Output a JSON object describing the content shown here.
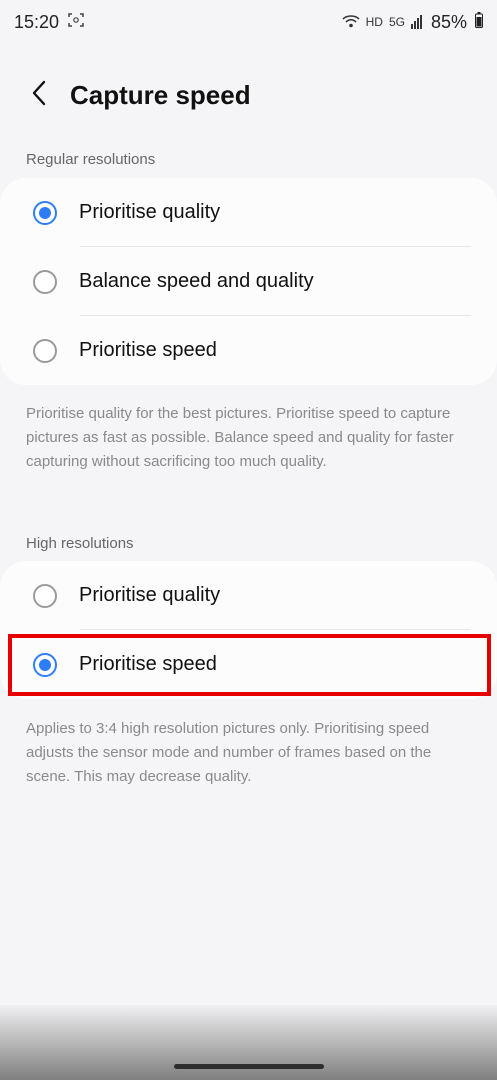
{
  "status_bar": {
    "time": "15:20",
    "network_label": "HD",
    "signal_label": "5G",
    "battery": "85%"
  },
  "header": {
    "title": "Capture speed"
  },
  "regular": {
    "section_label": "Regular resolutions",
    "options": [
      {
        "label": "Prioritise quality",
        "checked": true
      },
      {
        "label": "Balance speed and quality",
        "checked": false
      },
      {
        "label": "Prioritise speed",
        "checked": false
      }
    ],
    "description": "Prioritise quality for the best pictures. Prioritise speed to capture pictures as fast as possible. Balance speed and quality for faster capturing without sacrificing too much quality."
  },
  "high": {
    "section_label": "High resolutions",
    "options": [
      {
        "label": "Prioritise quality",
        "checked": false
      },
      {
        "label": "Prioritise speed",
        "checked": true
      }
    ],
    "description": "Applies to 3:4 high resolution pictures only. Prioritising speed adjusts the sensor mode and number of frames based on the scene. This may decrease quality."
  },
  "colors": {
    "accent": "#2f7df6",
    "highlight": "#e60000"
  }
}
